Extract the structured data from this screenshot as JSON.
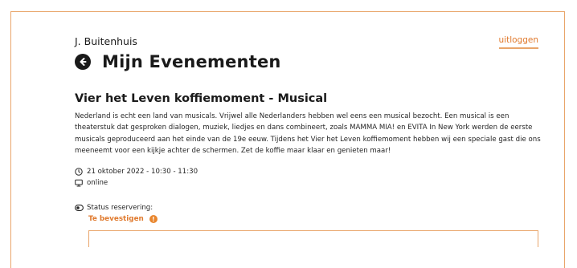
{
  "header": {
    "username": "J. Buitenhuis",
    "logout_label": "uitloggen",
    "page_title": "Mijn Evenementen"
  },
  "event": {
    "title": "Vier het Leven koffiemoment - Musical",
    "description": "Nederland is echt een land van musicals. Vrijwel alle Nederlanders hebben wel eens een musical bezocht. Een musical is een theaterstuk dat gesproken dialogen, muziek, liedjes en dans combineert, zoals MAMMA MIA! en EVITA In New York werden de eerste musicals geproduceerd aan het einde van de 19e eeuw. Tijdens het Vier het Leven koffiemoment hebben wij een speciale gast die ons meeneemt voor een kijkje achter de schermen. Zet de koffie maar klaar en genieten maar!",
    "datetime": "21 oktober 2022 - 10:30 - 11:30",
    "location": "online"
  },
  "status": {
    "label": "Status reservering:",
    "value": "Te bevestigen",
    "value_color": "#e07a2e"
  },
  "icons": {
    "back": "arrow-left-circle-icon",
    "clock": "clock-icon",
    "monitor": "monitor-icon",
    "toggle": "toggle-icon",
    "warning": "exclamation-circle-icon"
  },
  "colors": {
    "accent": "#e9a56a",
    "accent_text": "#e07a2e"
  }
}
